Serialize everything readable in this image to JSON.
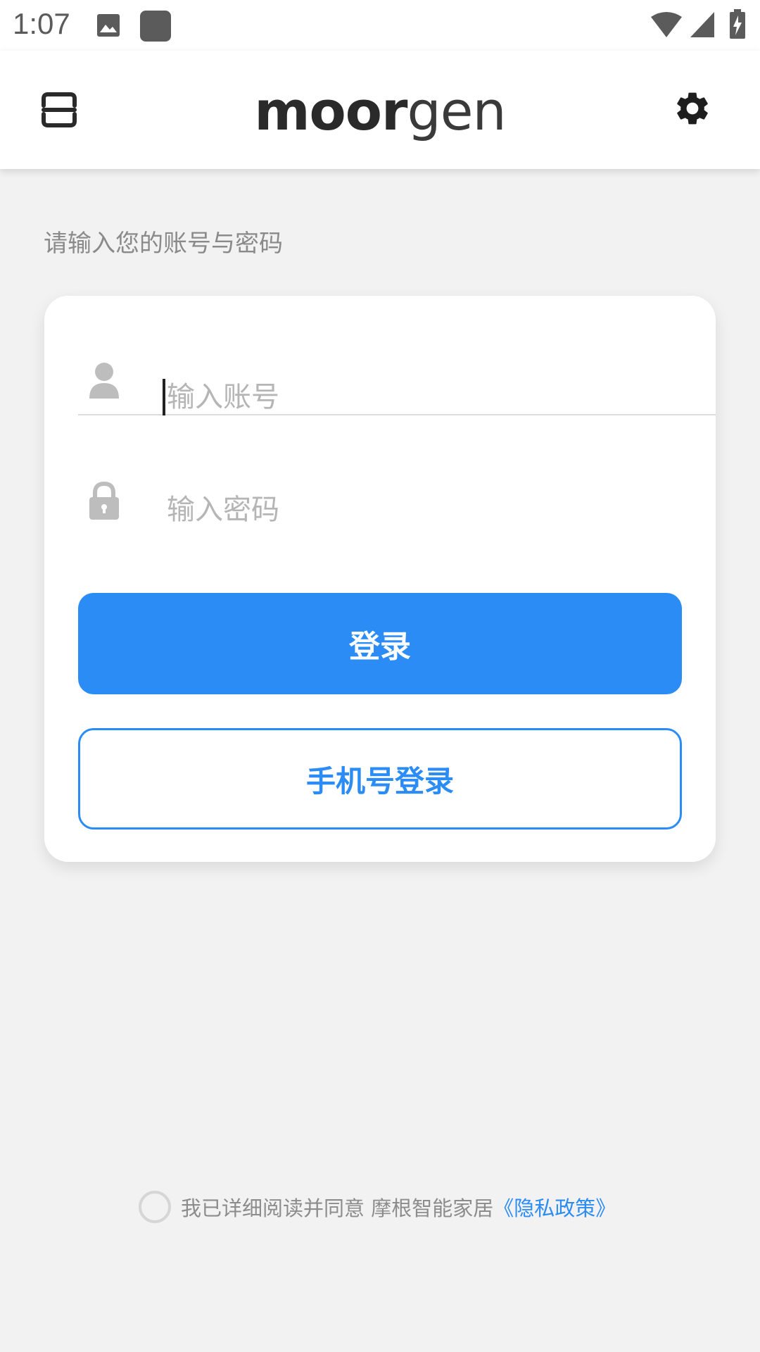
{
  "status_bar": {
    "time": "1:07",
    "icons": [
      "image-icon",
      "app-square-icon",
      "wifi-icon",
      "cell-signal-icon",
      "battery-charging-icon"
    ]
  },
  "header": {
    "logo_bold": "moor",
    "logo_light": "gen",
    "menu_icon": "scan-menu-icon",
    "settings_icon": "gear-icon"
  },
  "login": {
    "hint": "请输入您的账号与密码",
    "account_placeholder": "输入账号",
    "password_placeholder": "输入密码",
    "account_icon": "user-icon",
    "password_icon": "lock-icon",
    "login_label": "登录",
    "phone_login_label": "手机号登录"
  },
  "agreement": {
    "text": "我已详细阅读并同意 摩根智能家居",
    "link": "《隐私政策》",
    "checked": false
  },
  "colors": {
    "accent": "#2b8cf5",
    "background": "#f2f2f2",
    "card": "#ffffff"
  }
}
